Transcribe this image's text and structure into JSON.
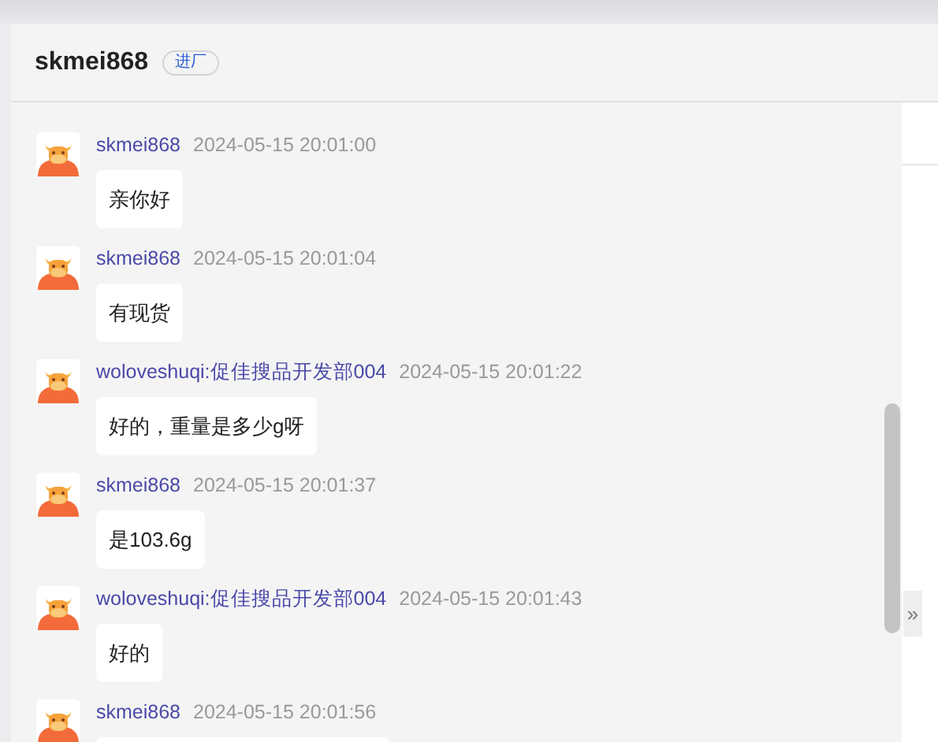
{
  "header": {
    "title": "skmei868",
    "tag": "进厂"
  },
  "messages": [
    {
      "sender": "skmei868",
      "time": "2024-05-15 20:01:00",
      "text": "亲你好"
    },
    {
      "sender": "skmei868",
      "time": "2024-05-15 20:01:04",
      "text": "有现货"
    },
    {
      "sender": "woloveshuqi:促佳搜品开发部004",
      "time": "2024-05-15 20:01:22",
      "text": "好的，重量是多少g呀"
    },
    {
      "sender": "skmei868",
      "time": "2024-05-15 20:01:37",
      "text": "是103.6g"
    },
    {
      "sender": "woloveshuqi:促佳搜品开发部004",
      "time": "2024-05-15 20:01:43",
      "text": "好的"
    },
    {
      "sender": "skmei868",
      "time": "2024-05-15 20:01:56"
    }
  ],
  "expand_button": {
    "label": "»"
  }
}
